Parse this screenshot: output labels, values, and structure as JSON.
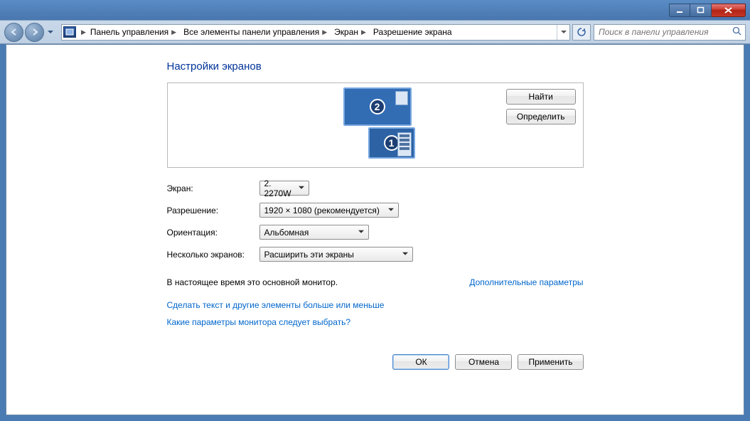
{
  "window": {
    "minimize_icon": "minimize",
    "maximize_icon": "maximize",
    "close_icon": "close"
  },
  "breadcrumbs": {
    "items": [
      {
        "label": "Панель управления"
      },
      {
        "label": "Все элементы панели управления"
      },
      {
        "label": "Экран"
      },
      {
        "label": "Разрешение экрана"
      }
    ]
  },
  "search": {
    "placeholder": "Поиск в панели управления"
  },
  "page": {
    "title": "Настройки экранов",
    "detect_button": "Найти",
    "identify_button": "Определить",
    "monitors": {
      "m1_badge": "1",
      "m2_badge": "2"
    },
    "labels": {
      "display": "Экран:",
      "resolution": "Разрешение:",
      "orientation": "Ориентация:",
      "multiple": "Несколько экранов:"
    },
    "values": {
      "display": "2. 2270W",
      "resolution": "1920 × 1080 (рекомендуется)",
      "orientation": "Альбомная",
      "multiple": "Расширить эти экраны"
    },
    "primary_note": "В настоящее время это основной монитор.",
    "advanced_link": "Дополнительные параметры",
    "text_size_link": "Сделать текст и другие элементы больше или меньше",
    "help_link": "Какие параметры монитора следует выбрать?",
    "buttons": {
      "ok": "ОК",
      "cancel": "Отмена",
      "apply": "Применить"
    }
  }
}
